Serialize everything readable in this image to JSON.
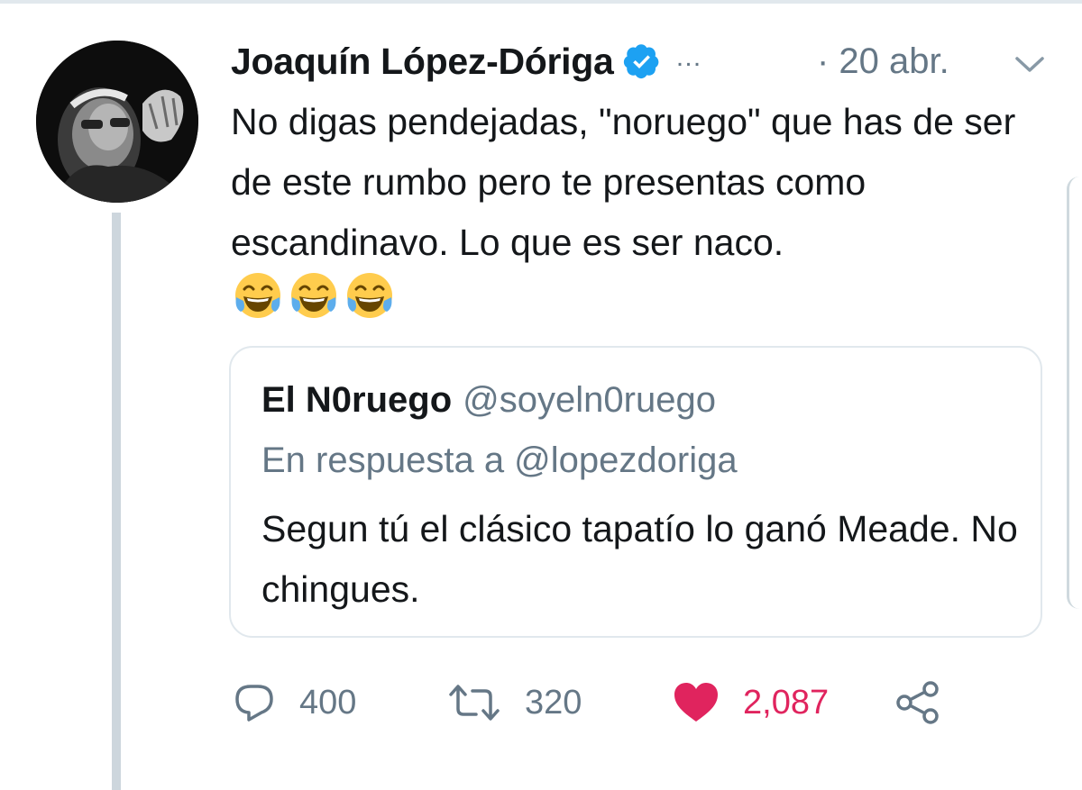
{
  "tweet": {
    "author_name": "Joaquín López-Dóriga",
    "more_indicator": "…",
    "date": "· 20 abr.",
    "text": "No digas pendejadas, \"noruego\" que has de ser de este rumbo pero te presentas como escandinavo. Lo que es ser naco.",
    "emojis": [
      "face-with-tears-of-joy",
      "face-with-tears-of-joy",
      "face-with-tears-of-joy"
    ]
  },
  "quoted_tweet": {
    "name": "El N0ruego",
    "handle": "@soyeln0ruego",
    "reply_to": "En respuesta a @lopezdoriga",
    "text": "Segun tú el clásico tapatío lo ganó Meade. No chingues."
  },
  "actions": {
    "reply_count": "400",
    "retweet_count": "320",
    "like_count": "2,087"
  },
  "icons": {
    "verified": "verified-badge-icon",
    "menu": "chevron-down-icon",
    "reply": "reply-icon",
    "retweet": "retweet-icon",
    "like": "heart-icon",
    "share": "share-icon"
  },
  "colors": {
    "verified_blue": "#1da1f2",
    "text_primary": "#14171a",
    "text_secondary": "#657786",
    "like_red": "#e0245e",
    "border": "#e1e8ed",
    "thread_line": "#cdd6dd"
  }
}
